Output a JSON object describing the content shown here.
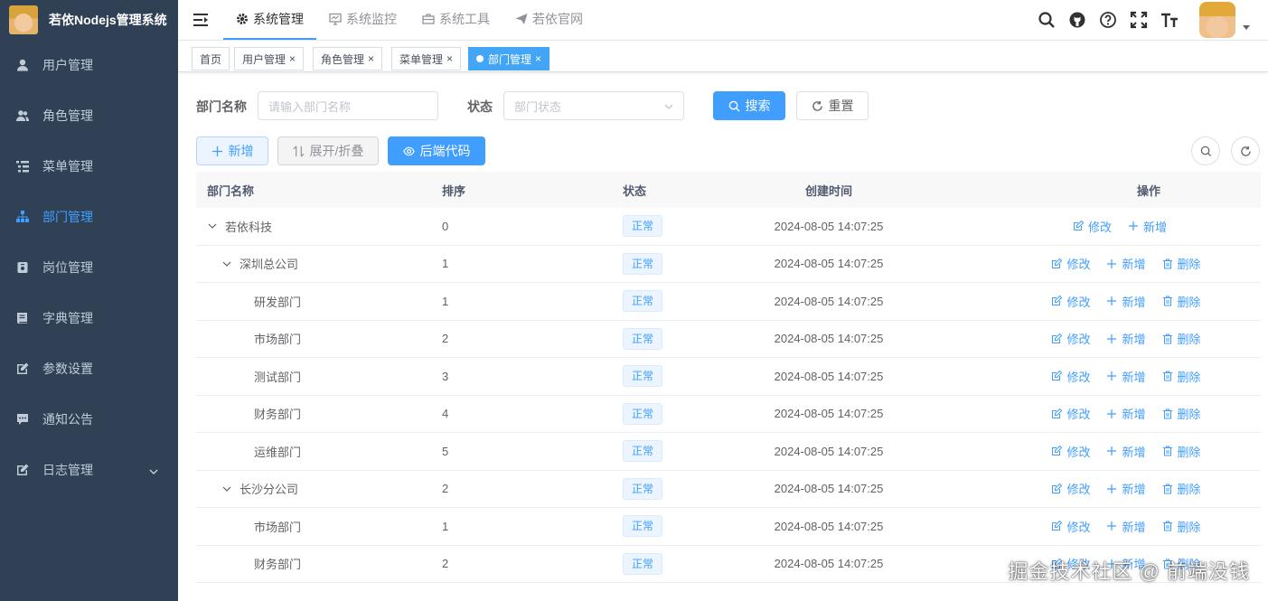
{
  "app": {
    "title": "若依Nodejs管理系统"
  },
  "sidebar": {
    "items": [
      {
        "label": "用户管理",
        "icon": "user-icon"
      },
      {
        "label": "角色管理",
        "icon": "peoples-icon"
      },
      {
        "label": "菜单管理",
        "icon": "tree-table-icon"
      },
      {
        "label": "部门管理",
        "icon": "tree-icon",
        "active": true
      },
      {
        "label": "岗位管理",
        "icon": "post-icon"
      },
      {
        "label": "字典管理",
        "icon": "dict-icon"
      },
      {
        "label": "参数设置",
        "icon": "edit-icon"
      },
      {
        "label": "通知公告",
        "icon": "message-icon"
      },
      {
        "label": "日志管理",
        "icon": "log-icon",
        "has_submenu": true
      }
    ]
  },
  "topnav": {
    "items": [
      {
        "label": "系统管理",
        "icon": "gear-icon",
        "active": true
      },
      {
        "label": "系统监控",
        "icon": "monitor-icon"
      },
      {
        "label": "系统工具",
        "icon": "toolbox-icon"
      },
      {
        "label": "若依官网",
        "icon": "paper-plane-icon"
      }
    ]
  },
  "tags": [
    {
      "label": "首页",
      "closable": false
    },
    {
      "label": "用户管理",
      "closable": true
    },
    {
      "label": "角色管理",
      "closable": true
    },
    {
      "label": "菜单管理",
      "closable": true
    },
    {
      "label": "部门管理",
      "closable": true,
      "active": true
    }
  ],
  "search": {
    "dept_label": "部门名称",
    "dept_placeholder": "请输入部门名称",
    "status_label": "状态",
    "status_placeholder": "部门状态",
    "search_btn": "搜索",
    "reset_btn": "重置"
  },
  "toolbar": {
    "add_btn": "新增",
    "expand_btn": "展开/折叠",
    "code_btn": "后端代码"
  },
  "table": {
    "headers": [
      "部门名称",
      "排序",
      "状态",
      "创建时间",
      "操作"
    ],
    "ops": {
      "edit": "修改",
      "add": "新增",
      "delete": "删除"
    },
    "rows": [
      {
        "name": "若依科技",
        "sort": "0",
        "status": "正常",
        "time": "2024-08-05 14:07:25",
        "level": 0,
        "expand": true,
        "delete": false
      },
      {
        "name": "深圳总公司",
        "sort": "1",
        "status": "正常",
        "time": "2024-08-05 14:07:25",
        "level": 1,
        "expand": true,
        "delete": true
      },
      {
        "name": "研发部门",
        "sort": "1",
        "status": "正常",
        "time": "2024-08-05 14:07:25",
        "level": 2,
        "expand": false,
        "delete": true
      },
      {
        "name": "市场部门",
        "sort": "2",
        "status": "正常",
        "time": "2024-08-05 14:07:25",
        "level": 2,
        "expand": false,
        "delete": true
      },
      {
        "name": "测试部门",
        "sort": "3",
        "status": "正常",
        "time": "2024-08-05 14:07:25",
        "level": 2,
        "expand": false,
        "delete": true
      },
      {
        "name": "财务部门",
        "sort": "4",
        "status": "正常",
        "time": "2024-08-05 14:07:25",
        "level": 2,
        "expand": false,
        "delete": true
      },
      {
        "name": "运维部门",
        "sort": "5",
        "status": "正常",
        "time": "2024-08-05 14:07:25",
        "level": 2,
        "expand": false,
        "delete": true
      },
      {
        "name": "长沙分公司",
        "sort": "2",
        "status": "正常",
        "time": "2024-08-05 14:07:25",
        "level": 1,
        "expand": true,
        "delete": true
      },
      {
        "name": "市场部门",
        "sort": "1",
        "status": "正常",
        "time": "2024-08-05 14:07:25",
        "level": 2,
        "expand": false,
        "delete": true
      },
      {
        "name": "财务部门",
        "sort": "2",
        "status": "正常",
        "time": "2024-08-05 14:07:25",
        "level": 2,
        "expand": false,
        "delete": true
      }
    ]
  },
  "watermark": "掘金技术社区 @ 前端没钱",
  "colors": {
    "sidebar_bg": "#304156",
    "accent": "#409eff",
    "sidebar_text": "#bfcbd9"
  }
}
